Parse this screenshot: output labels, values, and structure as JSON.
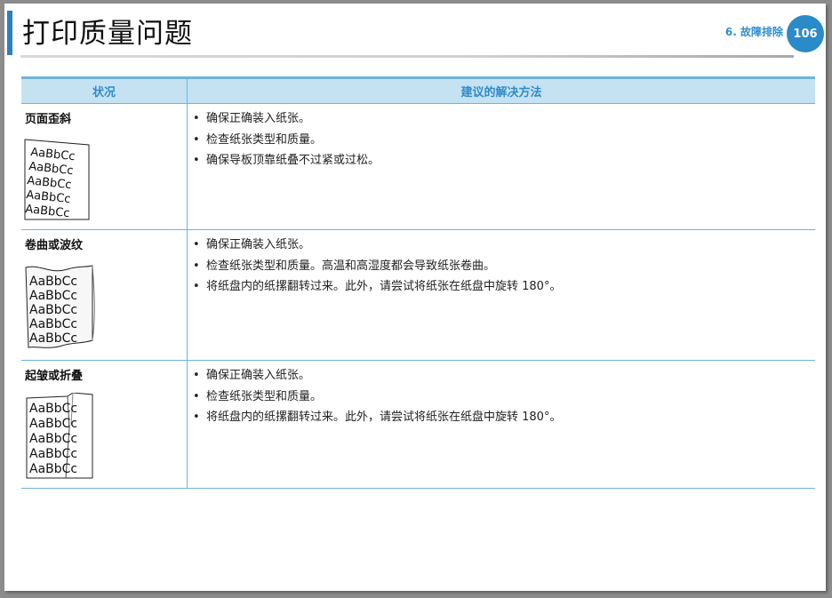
{
  "header": {
    "title": "打印质量问题",
    "chapter": "6.  故障排除",
    "page_number": "106"
  },
  "table": {
    "col_state": "状况",
    "col_solution": "建议的解决方法",
    "rows": [
      {
        "state": "页面歪斜",
        "solutions": [
          "确保正确装入纸张。",
          "检查纸张类型和质量。",
          "确保导板顶靠纸叠不过紧或过松。"
        ]
      },
      {
        "state": "卷曲或波纹",
        "solutions": [
          "确保正确装入纸张。",
          "检查纸张类型和质量。高温和高湿度都会导致纸张卷曲。",
          "将纸盘内的纸摞翻转过来。此外，请尝试将纸张在纸盘中旋转 180°。"
        ]
      },
      {
        "state": "起皱或折叠",
        "solutions": [
          "确保正确装入纸张。",
          "检查纸张类型和质量。",
          "将纸盘内的纸摞翻转过来。此外，请尝试将纸张在纸盘中旋转 180°。"
        ]
      }
    ]
  },
  "samples": {
    "skew_lines": [
      "AaBbCc",
      "AaBbCc",
      "AaBbCc",
      "AaBbCc",
      "AaBbCc"
    ],
    "curl_lines": [
      "AaBbCc",
      "AaBbCc",
      "AaBbCc",
      "AaBbCc",
      "AaBbCc"
    ],
    "wrinkle_lines": [
      "AaBbCc",
      "AaBbCc",
      "AaBbCc",
      "AaBbCc",
      "AaBbCc"
    ]
  },
  "colors": {
    "accent": "#2b8ac8",
    "header_fill": "#c5e2f3",
    "rule": "#6fb3dd"
  }
}
